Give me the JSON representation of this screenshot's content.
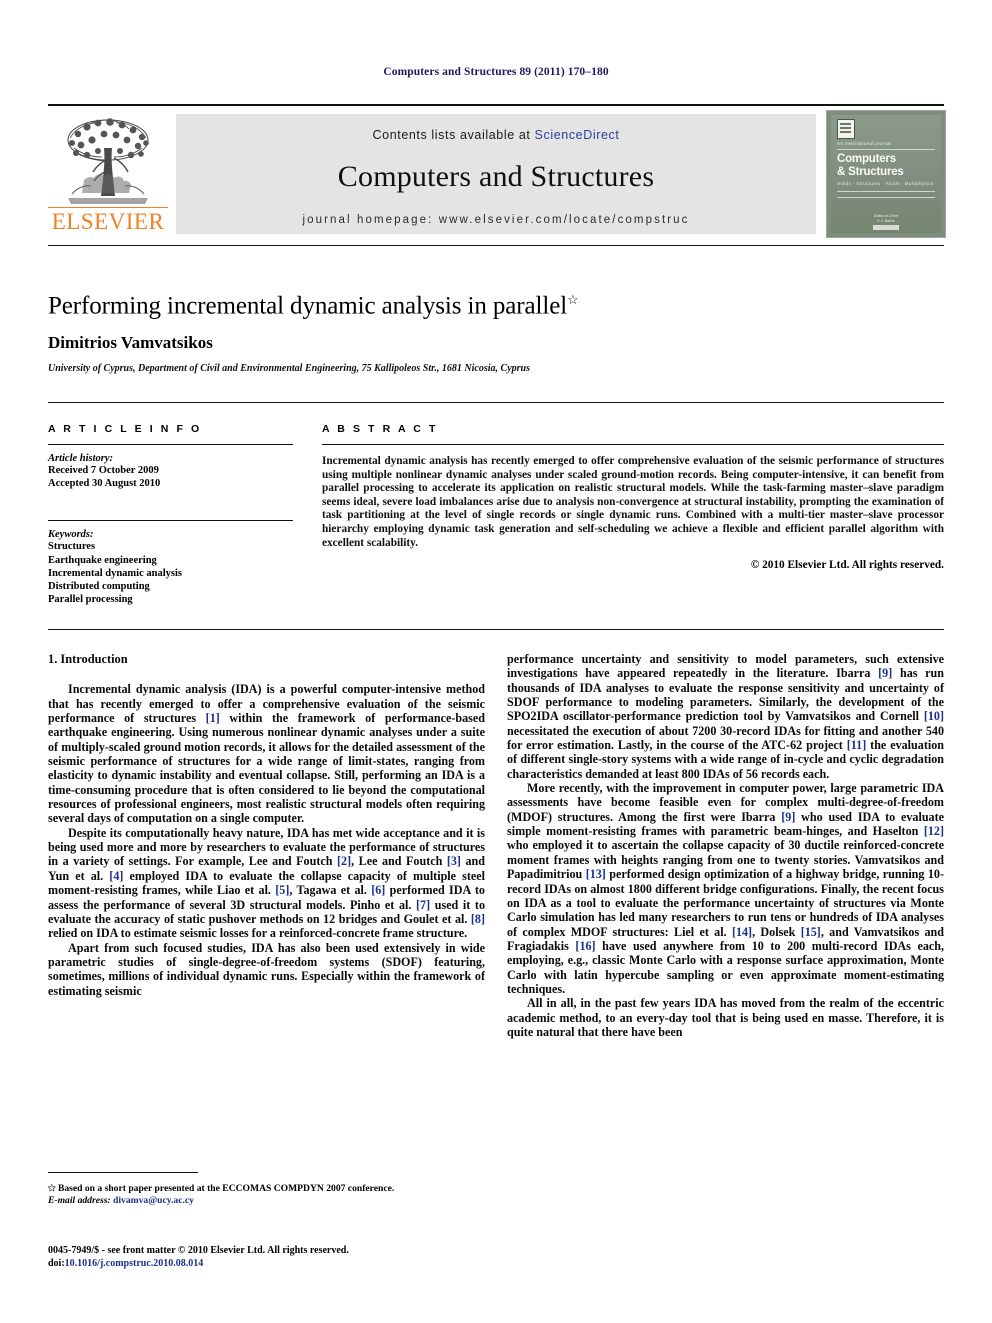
{
  "running_head": "Computers and Structures 89 (2011) 170–180",
  "masthead": {
    "publisher": "ELSEVIER",
    "contents_prefix": "Contents lists available at",
    "sciencedirect": "ScienceDirect",
    "journal_title": "Computers and Structures",
    "homepage": "journal homepage: www.elsevier.com/locate/compstruc",
    "cover": {
      "superline": "An international journal",
      "title_line1": "Computers",
      "title_line2": "& Structures",
      "subline": "Solids  ·  Structures  ·  Fluids  ·  Multiphysics",
      "foot_line1": "Editor-in-Chief",
      "foot_line2": "K.J. Bathe"
    }
  },
  "article": {
    "title": "Performing incremental dynamic analysis in parallel",
    "title_mark": "☆",
    "author": "Dimitrios Vamvatsikos",
    "affiliation": "University of Cyprus, Department of Civil and Environmental Engineering, 75 Kallipoleos Str., 1681 Nicosia, Cyprus"
  },
  "article_info": {
    "heading": "A R T I C L E   I N F O",
    "history_label": "Article history:",
    "received": "Received 7 October 2009",
    "accepted": "Accepted 30 August 2010",
    "keywords_label": "Keywords:",
    "keywords": [
      "Structures",
      "Earthquake engineering",
      "Incremental dynamic analysis",
      "Distributed computing",
      "Parallel processing"
    ]
  },
  "abstract": {
    "heading": "A B S T R A C T",
    "body": "Incremental dynamic analysis has recently emerged to offer comprehensive evaluation of the seismic performance of structures using multiple nonlinear dynamic analyses under scaled ground-motion records. Being computer-intensive, it can benefit from parallel processing to accelerate its application on realistic structural models. While the task-farming master–slave paradigm seems ideal, severe load imbalances arise due to analysis non-convergence at structural instability, prompting the examination of task partitioning at the level of single records or single dynamic runs. Combined with a multi-tier master–slave processor hierarchy employing dynamic task generation and self-scheduling we achieve a flexible and efficient parallel algorithm with excellent scalability.",
    "copyright": "© 2010 Elsevier Ltd. All rights reserved."
  },
  "body": {
    "section_heading": "1. Introduction",
    "left_paragraphs": [
      "Incremental dynamic analysis (IDA) is a powerful computer-intensive method that has recently emerged to offer a comprehensive evaluation of the seismic performance of structures [1] within the framework of performance-based earthquake engineering. Using numerous nonlinear dynamic analyses under a suite of multiply-scaled ground motion records, it allows for the detailed assessment of the seismic performance of structures for a wide range of limit-states, ranging from elasticity to dynamic instability and eventual collapse. Still, performing an IDA is a time-consuming procedure that is often considered to lie beyond the computational resources of professional engineers, most realistic structural models often requiring several days of computation on a single computer.",
      "Despite its computationally heavy nature, IDA has met wide acceptance and it is being used more and more by researchers to evaluate the performance of structures in a variety of settings. For example, Lee and Foutch [2], Lee and Foutch [3] and Yun et al. [4] employed IDA to evaluate the collapse capacity of multiple steel moment-resisting frames, while Liao et al. [5], Tagawa et al. [6] performed IDA to assess the performance of several 3D structural models. Pinho et al. [7] used it to evaluate the accuracy of static pushover methods on 12 bridges and Goulet et al. [8] relied on IDA to estimate seismic losses for a reinforced-concrete frame structure.",
      "Apart from such focused studies, IDA has also been used extensively in wide parametric studies of single-degree-of-freedom systems (SDOF) featuring, sometimes, millions of individual dynamic runs. Especially within the framework of estimating seismic"
    ],
    "right_paragraphs": [
      "performance uncertainty and sensitivity to model parameters, such extensive investigations have appeared repeatedly in the literature. Ibarra [9] has run thousands of IDA analyses to evaluate the response sensitivity and uncertainty of SDOF performance to modeling parameters. Similarly, the development of the SPO2IDA oscillator-performance prediction tool by Vamvatsikos and Cornell [10] necessitated the execution of about 7200 30-record IDAs for fitting and another 540 for error estimation. Lastly, in the course of the ATC-62 project [11] the evaluation of different single-story systems with a wide range of in-cycle and cyclic degradation characteristics demanded at least 800 IDAs of 56 records each.",
      "More recently, with the improvement in computer power, large parametric IDA assessments have become feasible even for complex multi-degree-of-freedom (MDOF) structures. Among the first were Ibarra [9] who used IDA to evaluate simple moment-resisting frames with parametric beam-hinges, and Haselton [12] who employed it to ascertain the collapse capacity of 30 ductile reinforced-concrete moment frames with heights ranging from one to twenty stories. Vamvatsikos and Papadimitriou [13] performed design optimization of a highway bridge, running 10-record IDAs on almost 1800 different bridge configurations. Finally, the recent focus on IDA as a tool to evaluate the performance uncertainty of structures via Monte Carlo simulation has led many researchers to run tens or hundreds of IDA analyses of complex MDOF structures: Liel et al. [14], Dolsek [15], and Vamvatsikos and Fragiadakis [16] have used anywhere from 10 to 200 multi-record IDAs each, employing, e.g., classic Monte Carlo with a response surface approximation, Monte Carlo with latin hypercube sampling or even approximate moment-estimating techniques.",
      "All in all, in the past few years IDA has moved from the realm of the eccentric academic method, to an every-day tool that is being used en masse. Therefore, it is quite natural that there have been"
    ]
  },
  "footnote": {
    "mark": "✩",
    "text": "Based on a short paper presented at the ECCOMAS COMPDYN 2007 conference.",
    "email_label": "E-mail address:",
    "email": "divamva@ucy.ac.cy"
  },
  "footer": {
    "issn_line": "0045-7949/$ - see front matter © 2010 Elsevier Ltd. All rights reserved.",
    "doi_label": "doi:",
    "doi": "10.1016/j.compstruc.2010.08.014"
  },
  "colors": {
    "running_head": "#1b1b64",
    "link": "#2a3f9d",
    "citation": "#1b2f8f",
    "elsevier_orange": "#f08024",
    "masthead_band": "#e4e4e4"
  }
}
